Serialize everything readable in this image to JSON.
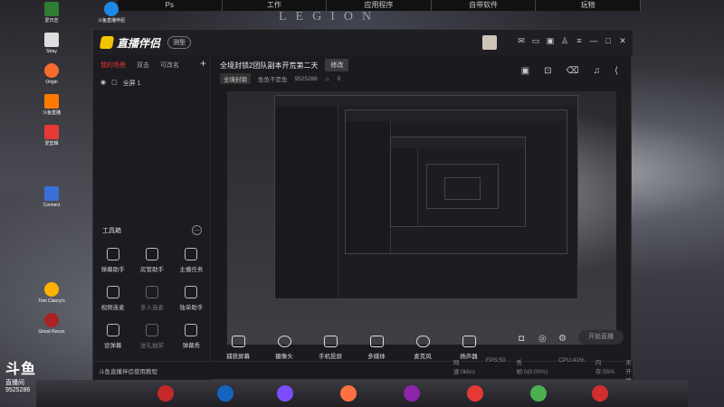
{
  "desktop": {
    "topbar_tabs": [
      "Ps",
      "工作",
      "应用程序",
      "自带软件",
      "玩物"
    ],
    "wallpaper_text": "LEGION",
    "icons": [
      {
        "label": "爱日志",
        "color": "#2e7d32"
      },
      {
        "label": "Stray",
        "color": "#dddddd"
      },
      {
        "label": "Origin",
        "color": "#f56c2d"
      },
      {
        "label": "斗鱼直播",
        "color": "#ff7a00"
      },
      {
        "label": "爱剪辑",
        "color": "#e53935"
      },
      {
        "label": "Connect",
        "color": "#3a6fd8"
      },
      {
        "label": "Tom Clancy's",
        "color": "#ffb300"
      },
      {
        "label": "Ghost Recon",
        "color": "#aa2222"
      },
      {
        "label": "斗鱼直播伴侣",
        "color": "#1e88e5"
      }
    ]
  },
  "app": {
    "name": "直播伴侣",
    "version_badge": "测型",
    "tabs": {
      "my_scenes": "我的场景",
      "duet": "双击",
      "modify": "可改名"
    },
    "scene_item": "全屏 1",
    "tool_section_title": "工具箱",
    "tools": [
      {
        "label": "弹幕助手",
        "enabled": true
      },
      {
        "label": "房管助手",
        "enabled": true
      },
      {
        "label": "主播任务",
        "enabled": true
      },
      {
        "label": "视频连麦",
        "enabled": true
      },
      {
        "label": "多人连麦",
        "enabled": false
      },
      {
        "label": "独单助手",
        "enabled": true
      },
      {
        "label": "设弹幕",
        "enabled": true
      },
      {
        "label": "送礼抽奖",
        "enabled": false
      },
      {
        "label": "弹幕秀",
        "enabled": true
      }
    ],
    "room_title": "全境封锁2团队副本开荒第二天",
    "edit_label": "修改",
    "category": "全境封锁",
    "streamer_name": "鱼鱼不是鱼",
    "room_id": "9525286",
    "fans": "0",
    "bottom_tools": [
      {
        "label": "捕获屏幕"
      },
      {
        "label": "摄像头"
      },
      {
        "label": "手机投屏"
      },
      {
        "label": "多媒体"
      },
      {
        "label": "麦克风"
      },
      {
        "label": "扬声器"
      }
    ],
    "start_label": "开始直播",
    "footer_tip": "斗鱼直播伴侣使用教程",
    "stats": {
      "net": "网速:0kb/s",
      "fps": "FPS:50",
      "drop": "丢帧:0(0.00%)",
      "cpu": "CPU:41%",
      "mem": "内存:55%",
      "status": "未开播"
    }
  },
  "overlay": {
    "brand": "斗鱼",
    "sub": "直播间",
    "id": "9525286"
  },
  "taskbar": {
    "colors": [
      "#c62828",
      "#1565c0",
      "#7c4dff",
      "#ff7043",
      "#8e24aa",
      "#e53935",
      "#4caf50",
      "#d32f2f"
    ]
  }
}
